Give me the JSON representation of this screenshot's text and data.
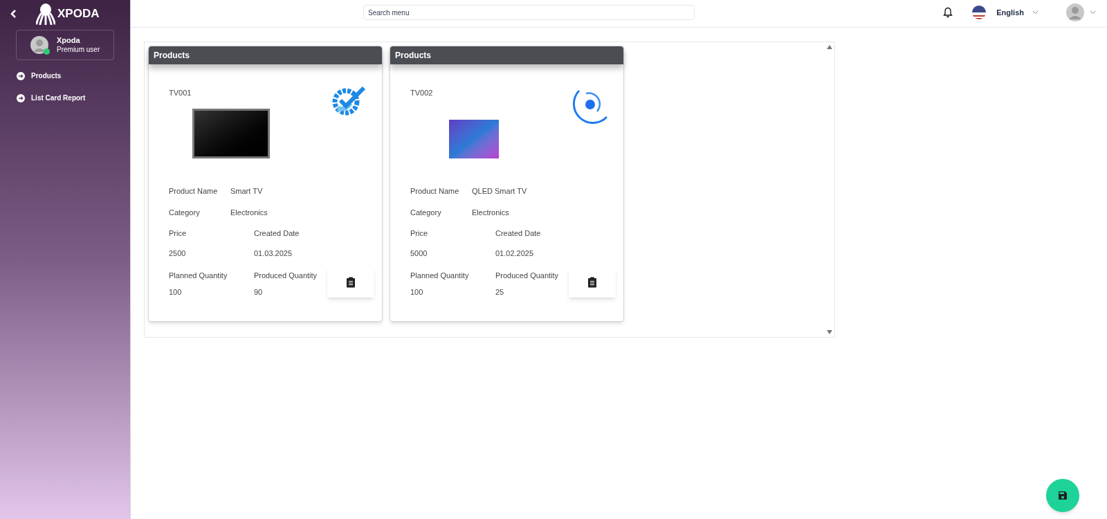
{
  "sidebar": {
    "logo": "XPODA",
    "user": {
      "name": "Xpoda",
      "role": "Premium user",
      "online": true
    },
    "items": [
      {
        "label": "Products"
      },
      {
        "label": "List Card Report"
      }
    ]
  },
  "topbar": {
    "search": {
      "placeholder": "Search menu"
    },
    "language": "English"
  },
  "cards": [
    {
      "header": "Products",
      "code": "TV001",
      "kind": "completed",
      "fields": {
        "product_name_label": "Product Name",
        "product_name": "Smart TV",
        "category_label": "Category",
        "category": "Electronics",
        "price_label": "Price",
        "price": "2500",
        "created_label": "Created Date",
        "created": "01.03.2025",
        "planned_label": "Planned Quantity",
        "planned": "100",
        "produced_label": "Produced Quantity",
        "produced": "90"
      }
    },
    {
      "header": "Products",
      "code": "TV002",
      "kind": "in-progress",
      "fields": {
        "product_name_label": "Product Name",
        "product_name": "QLED Smart TV",
        "category_label": "Category",
        "category": "Electronics",
        "price_label": "Price",
        "price": "5000",
        "created_label": "Created Date",
        "created": "01.02.2025",
        "planned_label": "Planned Quantity",
        "planned": "100",
        "produced_label": "Produced Quantity",
        "produced": "25"
      }
    }
  ]
}
